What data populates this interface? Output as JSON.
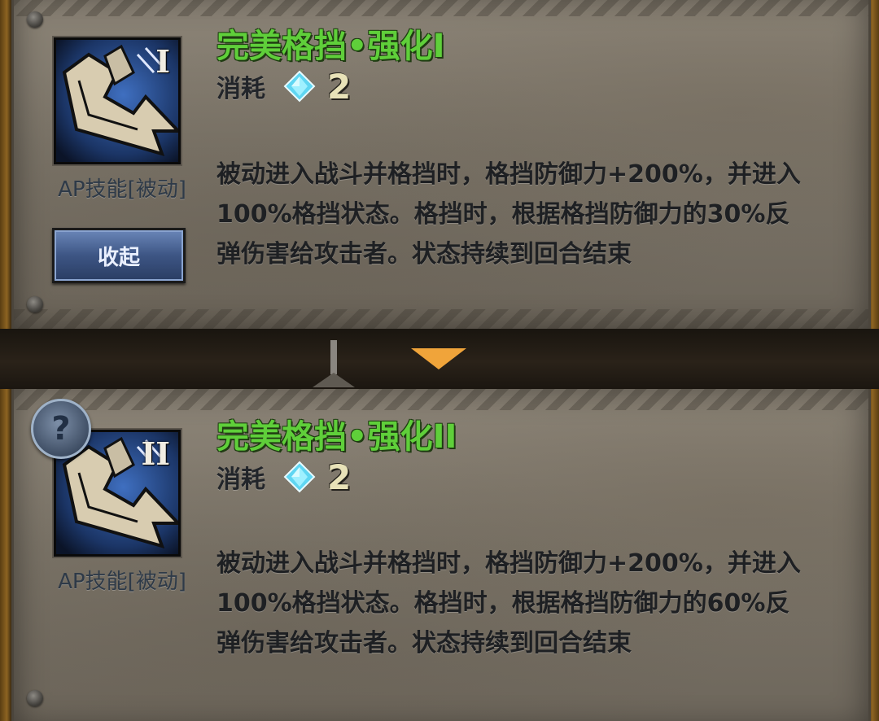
{
  "skills": [
    {
      "title": "完美格挡•强化I",
      "roman": "I",
      "type_label": "AP技能[被动]",
      "cost_label": "消耗",
      "cost_value": "2",
      "cost_icon": "diamond-gem-icon",
      "description": "被动进入战斗并格挡时，格挡防御力+200%，并进入100%格挡状态。格挡时，根据格挡防御力的30%反弹伤害给攻击者。状态持续到回合结束"
    },
    {
      "title": "完美格挡•强化II",
      "roman": "II",
      "type_label": "AP技能[被动]",
      "cost_label": "消耗",
      "cost_value": "2",
      "cost_icon": "diamond-gem-icon",
      "description": "被动进入战斗并格挡时，格挡防御力+200%，并进入100%格挡状态。格挡时，根据格挡防御力的60%反弹伤害给攻击者。状态持续到回合结束"
    }
  ],
  "collapse_button": {
    "label": "收起"
  },
  "help_button": {
    "label": "?"
  },
  "colors": {
    "title_green": "#5fcf3a",
    "panel_parchment": "#7b7468",
    "button_blue": "#3d5584",
    "indicator_orange": "#f0a43a"
  }
}
